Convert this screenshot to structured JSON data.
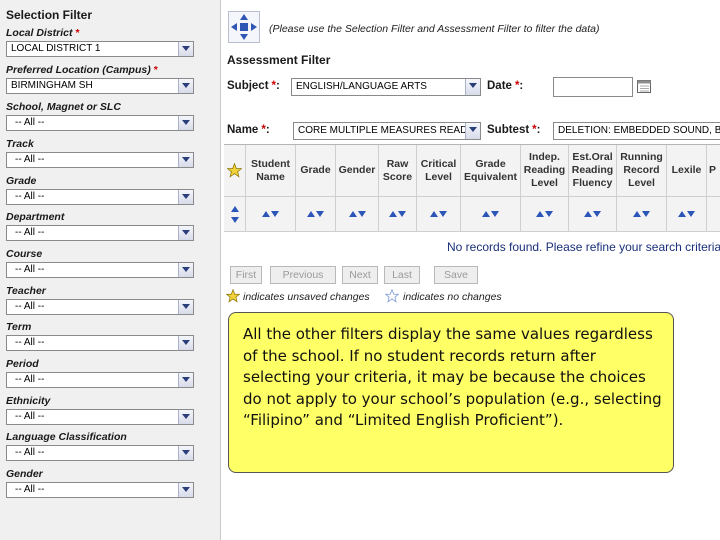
{
  "left": {
    "title": "Selection Filter",
    "filters": [
      {
        "label": "Local District",
        "required": true,
        "value": "LOCAL DISTRICT 1"
      },
      {
        "label": "Preferred Location (Campus)",
        "required": true,
        "value": "BIRMINGHAM SH"
      },
      {
        "label": "School, Magnet or SLC",
        "required": false,
        "value": "-- All --"
      },
      {
        "label": "Track",
        "required": false,
        "value": "-- All --"
      },
      {
        "label": "Grade",
        "required": false,
        "value": "-- All --"
      },
      {
        "label": "Department",
        "required": false,
        "value": "-- All --"
      },
      {
        "label": "Course",
        "required": false,
        "value": "-- All --"
      },
      {
        "label": "Teacher",
        "required": false,
        "value": "-- All --"
      },
      {
        "label": "Term",
        "required": false,
        "value": "-- All --"
      },
      {
        "label": "Period",
        "required": false,
        "value": "-- All --"
      },
      {
        "label": "Ethnicity",
        "required": false,
        "value": "-- All --"
      },
      {
        "label": "Language Classification",
        "required": false,
        "value": "-- All --"
      },
      {
        "label": "Gender",
        "required": false,
        "value": "-- All --"
      }
    ],
    "required_marker": "*"
  },
  "hint": "(Please use the Selection Filter and Assessment Filter to filter the data)",
  "assessment": {
    "title": "Assessment Filter",
    "subject_label": "Subject",
    "subject_value": "ENGLISH/LANGUAGE ARTS",
    "date_label": "Date",
    "date_value": "",
    "name_label": "Name",
    "name_value": "CORE MULTIPLE MEASURES READIN",
    "subtest_label": "Subtest",
    "subtest_value": "DELETION: EMBEDDED SOUND, BLE",
    "label_suffix": ":"
  },
  "grid": {
    "columns": [
      {
        "name": "student-name",
        "label": "Student Name"
      },
      {
        "name": "grade",
        "label": "Grade"
      },
      {
        "name": "gender",
        "label": "Gender"
      },
      {
        "name": "raw-score",
        "label": "Raw Score"
      },
      {
        "name": "critical-level",
        "label": "Critical Level"
      },
      {
        "name": "grade-equivalent",
        "label": "Grade Equivalent"
      },
      {
        "name": "indep-reading-level",
        "label": "Indep. Reading Level"
      },
      {
        "name": "est-oral-reading-fluency",
        "label": "Est.Oral Reading Fluency"
      },
      {
        "name": "running-record-level",
        "label": "Running Record Level"
      },
      {
        "name": "lexile",
        "label": "Lexile"
      },
      {
        "name": "p-column",
        "label": "P"
      }
    ],
    "no_records": "No records found. Please refine your search criteria."
  },
  "pager": {
    "first": "First",
    "previous": "Previous",
    "next": "Next",
    "last": "Last",
    "save": "Save"
  },
  "legend": {
    "unsaved": "indicates unsaved changes",
    "no_changes": "indicates no changes"
  },
  "note": "All the other filters display the same values regardless of the school. If no student records return after selecting your criteria, it may be because the choices do not apply to your school’s population (e.g., selecting “Filipino” and “Limited English Proficient”).",
  "colors": {
    "note_bg": "#ffff66",
    "sort_arrow": "#2c55b8",
    "required": "#cc0000",
    "star_yellow": "#f2d23a"
  }
}
